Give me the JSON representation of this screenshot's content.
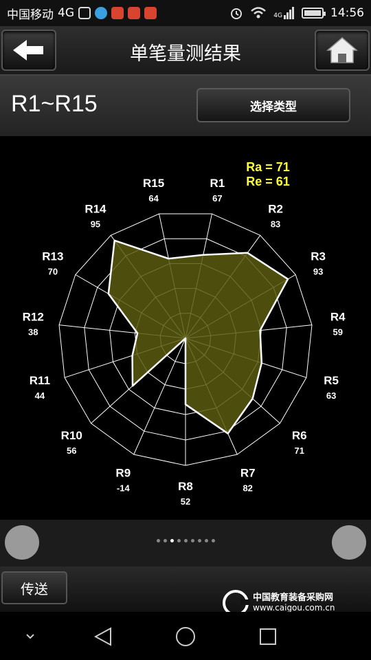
{
  "status_bar": {
    "carrier": "中国移动",
    "network": "4G",
    "signal_net": "4G",
    "time": "14:56",
    "icons": [
      "gallery-icon",
      "browser-icon",
      "app-notification-icon",
      "app-notification-icon",
      "app-notification-icon",
      "alarm-icon",
      "wifi-icon",
      "signal-icon",
      "battery-icon"
    ]
  },
  "header": {
    "title": "单笔量测结果",
    "back_icon": "arrow-left-icon",
    "home_icon": "home-icon"
  },
  "range": {
    "label": "R1~R15",
    "select_type_label": "选择类型"
  },
  "chart_data": {
    "type": "radar",
    "summary": [
      "Ra = 71",
      "Re = 61"
    ],
    "rings": 5,
    "series_color": "#5b5b10",
    "line_color": "#ffffff",
    "axes": [
      {
        "label": "R1",
        "value": 67
      },
      {
        "label": "R2",
        "value": 83
      },
      {
        "label": "R3",
        "value": 93
      },
      {
        "label": "R4",
        "value": 59
      },
      {
        "label": "R5",
        "value": 63
      },
      {
        "label": "R6",
        "value": 71
      },
      {
        "label": "R7",
        "value": 82
      },
      {
        "label": "R8",
        "value": 52
      },
      {
        "label": "R9",
        "value": -14
      },
      {
        "label": "R10",
        "value": 56
      },
      {
        "label": "R11",
        "value": 44
      },
      {
        "label": "R12",
        "value": 38
      },
      {
        "label": "R13",
        "value": 70
      },
      {
        "label": "R14",
        "value": 95
      },
      {
        "label": "R15",
        "value": 64
      }
    ]
  },
  "pager": {
    "page_count": 9,
    "active_index": 2
  },
  "footer": {
    "send_label": "传送",
    "watermark_title": "中国教育装备采购网",
    "watermark_url": "www.caigou.com.cn"
  },
  "nav": {
    "icons": [
      "hide-keyboard-icon",
      "back-icon",
      "home-icon",
      "recents-icon"
    ]
  }
}
